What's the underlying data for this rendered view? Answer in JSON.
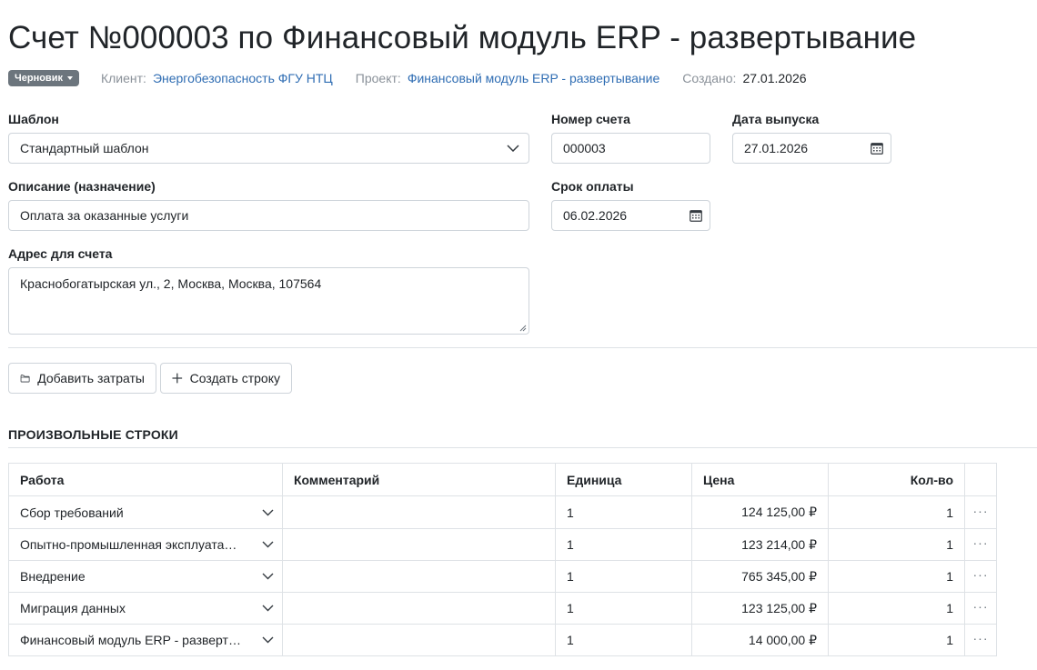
{
  "header": {
    "title": "Счет №000003 по Финансовый модуль ERP - развертывание",
    "status_badge": "Черновик",
    "client_label": "Клиент:",
    "client_value": "Энергобезопасность ФГУ НТЦ",
    "project_label": "Проект:",
    "project_value": "Финансовый модуль ERP - развертывание",
    "created_label": "Создано:",
    "created_value": "27.01.2026"
  },
  "form": {
    "template_label": "Шаблон",
    "template_value": "Стандартный шаблон",
    "number_label": "Номер счета",
    "number_value": "000003",
    "issue_date_label": "Дата выпуска",
    "issue_date_value": "27.01.2026",
    "description_label": "Описание (назначение)",
    "description_value": "Оплата за оказанные услуги",
    "due_date_label": "Срок оплаты",
    "due_date_value": "06.02.2026",
    "address_label": "Адрес для счета",
    "address_value": "Краснобогатырская ул., 2, Москва, Москва, 107564"
  },
  "actions": {
    "add_expenses": "Добавить затраты",
    "create_row": "Создать строку"
  },
  "section": {
    "title": "ПРОИЗВОЛЬНЫЕ СТРОКИ"
  },
  "table": {
    "headers": [
      "Работа",
      "Комментарий",
      "Единица",
      "Цена",
      "Кол-во"
    ],
    "rows": [
      {
        "work": "Сбор требований",
        "comment": "",
        "unit": "1",
        "price": "124 125,00 ₽",
        "qty": "1"
      },
      {
        "work": "Опытно-промышленная эксплуатация",
        "comment": "",
        "unit": "1",
        "price": "123 214,00 ₽",
        "qty": "1"
      },
      {
        "work": "Внедрение",
        "comment": "",
        "unit": "1",
        "price": "765 345,00 ₽",
        "qty": "1"
      },
      {
        "work": "Миграция данных",
        "comment": "",
        "unit": "1",
        "price": "123 125,00 ₽",
        "qty": "1"
      },
      {
        "work": "Финансовый модуль ERP - развертывание",
        "comment": "",
        "unit": "1",
        "price": "14 000,00 ₽",
        "qty": "1"
      }
    ],
    "row_menu_glyph": "···"
  },
  "icons": {
    "badge_caret": "caret-down-icon",
    "select_chevron": "chevron-down-icon",
    "calendar": "calendar-icon",
    "folder": "folder-icon",
    "plus": "plus-icon",
    "more": "more-horizontal-icon"
  },
  "colors": {
    "link": "#2f6db3",
    "badge_bg": "#6c757d",
    "border": "#ced4da",
    "muted": "#8a9199"
  }
}
